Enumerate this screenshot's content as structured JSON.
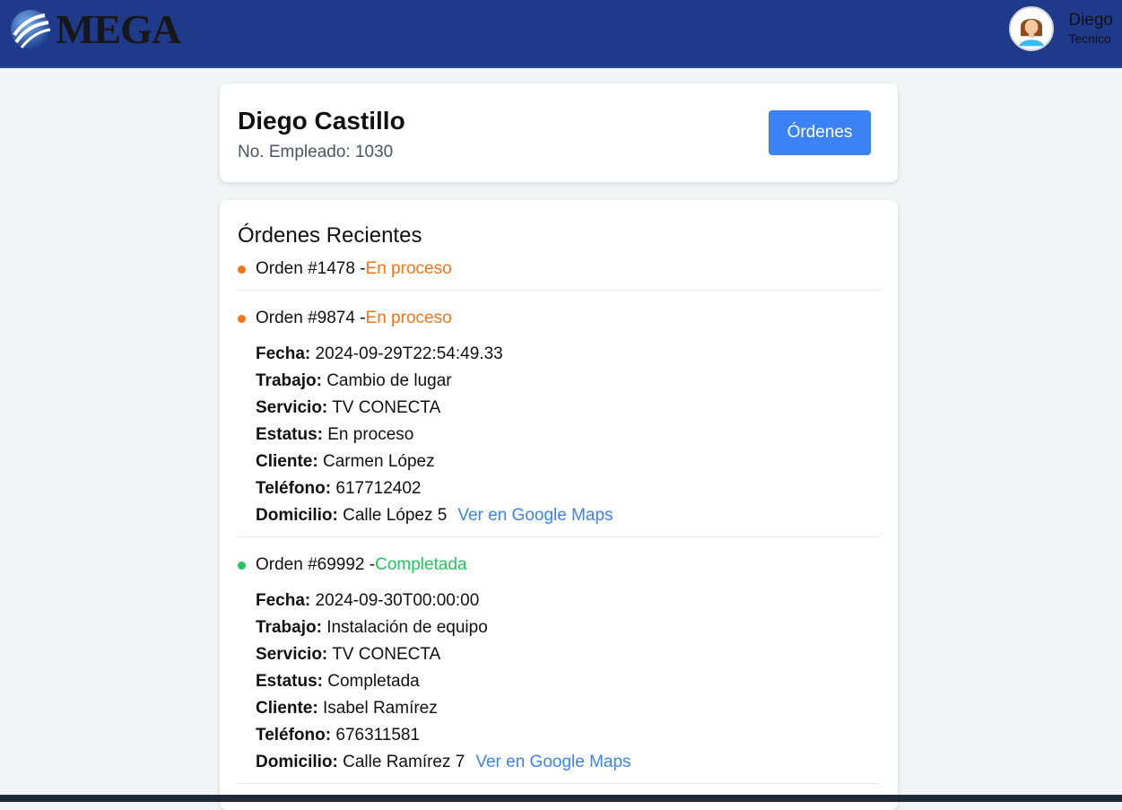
{
  "brand": {
    "logo_text": "MEGA"
  },
  "user": {
    "name": "Diego",
    "role": "Tecnico"
  },
  "profile": {
    "full_name": "Diego Castillo",
    "employee_number": "No. Empleado: 1030",
    "orders_button": "Órdenes"
  },
  "orders_section": {
    "title": "Órdenes Recientes",
    "labels": {
      "fecha": "Fecha:",
      "trabajo": "Trabajo:",
      "servicio": "Servicio:",
      "estatus": "Estatus:",
      "cliente": "Cliente:",
      "telefono": "Teléfono:",
      "domicilio": "Domicilio:",
      "maps_link": "Ver en Google Maps"
    },
    "orders": [
      {
        "title": "Orden #1478 -",
        "status": "En proceso"
      },
      {
        "title": "Orden #9874 -",
        "status": "En proceso",
        "fecha": "2024-09-29T22:54:49.33",
        "trabajo": "Cambio de lugar",
        "servicio": "TV CONECTA",
        "estatus": "En proceso",
        "cliente": "Carmen López",
        "telefono": "617712402",
        "domicilio": "Calle López 5"
      },
      {
        "title": "Orden #69992 -",
        "status": "Completada",
        "fecha": "2024-09-30T00:00:00",
        "trabajo": "Instalación de equipo",
        "servicio": "TV CONECTA",
        "estatus": "Completada",
        "cliente": "Isabel Ramírez",
        "telefono": "676311581",
        "domicilio": "Calle Ramírez 7"
      }
    ]
  },
  "colors": {
    "topbar": "#1f3a8a",
    "primary_button": "#3b82f6",
    "status_in_progress": "#f97316",
    "status_completed": "#22c55e"
  }
}
